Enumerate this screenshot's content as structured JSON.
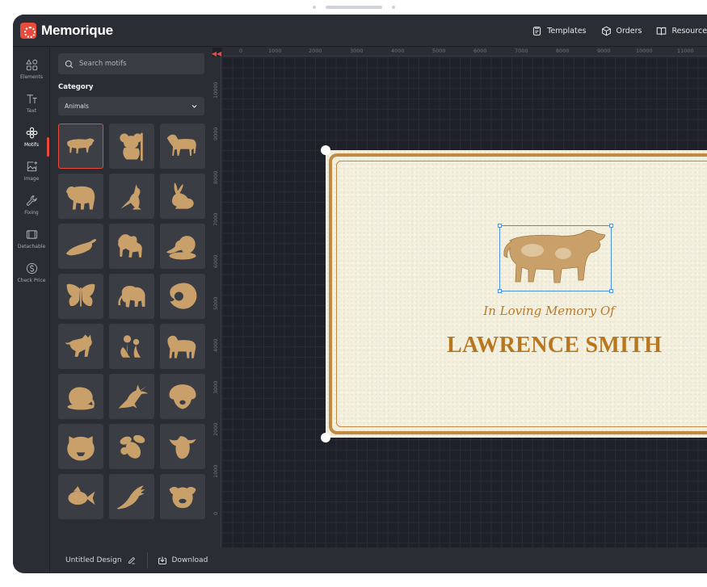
{
  "app": {
    "name": "Memorique"
  },
  "header": {
    "nav": [
      {
        "label": "Templates",
        "icon": "template-icon"
      },
      {
        "label": "Orders",
        "icon": "box-icon"
      },
      {
        "label": "Resources",
        "icon": "book-icon"
      }
    ]
  },
  "rail": {
    "items": [
      {
        "label": "Elements",
        "icon": "elements-icon"
      },
      {
        "label": "Text",
        "icon": "text-icon"
      },
      {
        "label": "Motifs",
        "icon": "flower-icon",
        "active": true
      },
      {
        "label": "Image",
        "icon": "image-icon"
      },
      {
        "label": "Fixing",
        "icon": "wrench-icon"
      },
      {
        "label": "Detachable",
        "icon": "detachable-icon"
      },
      {
        "label": "Check Price",
        "icon": "dollar-icon"
      }
    ]
  },
  "panel": {
    "search_placeholder": "Search motifs",
    "category_label": "Category",
    "category_value": "Animals",
    "motifs": [
      "bull",
      "koala",
      "horse",
      "bear",
      "kangaroo",
      "rabbit",
      "platypus",
      "dog",
      "squirrel",
      "butterfly",
      "elephant",
      "lion",
      "cat",
      "flowers",
      "pony",
      "rat",
      "swordfish",
      "labrador",
      "tiger",
      "bee",
      "cow",
      "goldfish",
      "eagle",
      "pug"
    ],
    "selected_motif": "bull"
  },
  "ruler": {
    "top": [
      "0",
      "1000",
      "2000",
      "3000",
      "4000",
      "5000",
      "6000",
      "7000",
      "8000",
      "9000",
      "10000",
      "11000"
    ],
    "left": [
      "10000",
      "9000",
      "8000",
      "7000",
      "6000",
      "5000",
      "4000",
      "3000",
      "2000",
      "1000",
      "0"
    ]
  },
  "plaque": {
    "subtitle": "In Loving Memory Of",
    "name": "LAWRENCE SMITH",
    "background_color": "#f3efdd",
    "border_color": "#c08a45",
    "text_color": "#b8761f"
  },
  "footer": {
    "title": "Untitled Design",
    "download_label": "Download"
  },
  "colors": {
    "accent": "#e94a3c",
    "app_bg": "#2b2d35",
    "canvas_bg": "#1f212a",
    "selection": "#4a90e2",
    "motif": "#c9a06a"
  }
}
